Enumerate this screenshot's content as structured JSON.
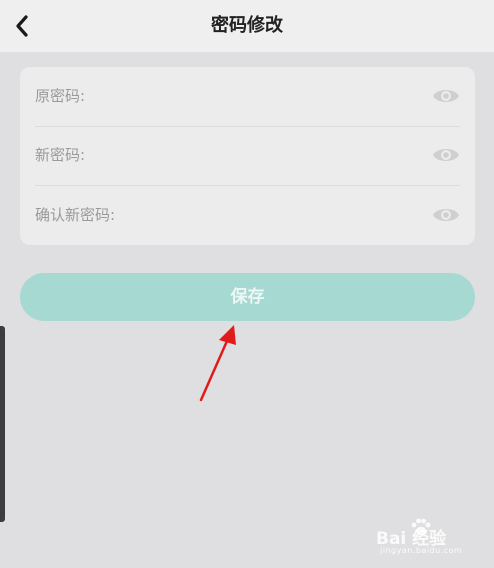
{
  "header": {
    "title": "密码修改",
    "back_icon": "chevron-left-icon"
  },
  "form": {
    "fields": [
      {
        "label": "原密码:",
        "value": "",
        "toggle_icon": "eye-icon"
      },
      {
        "label": "新密码:",
        "value": "",
        "toggle_icon": "eye-icon"
      },
      {
        "label": "确认新密码:",
        "value": "",
        "toggle_icon": "eye-icon"
      }
    ]
  },
  "save_button": {
    "label": "保存"
  },
  "colors": {
    "background": "#dfdfe1",
    "header_background": "#efefef",
    "card_background": "#ececec",
    "save_button": "#a6d9d2",
    "annotation_arrow": "#e01b1b"
  },
  "watermark": {
    "text": "Bai 经验",
    "url": "jingyan.baidu.com"
  }
}
